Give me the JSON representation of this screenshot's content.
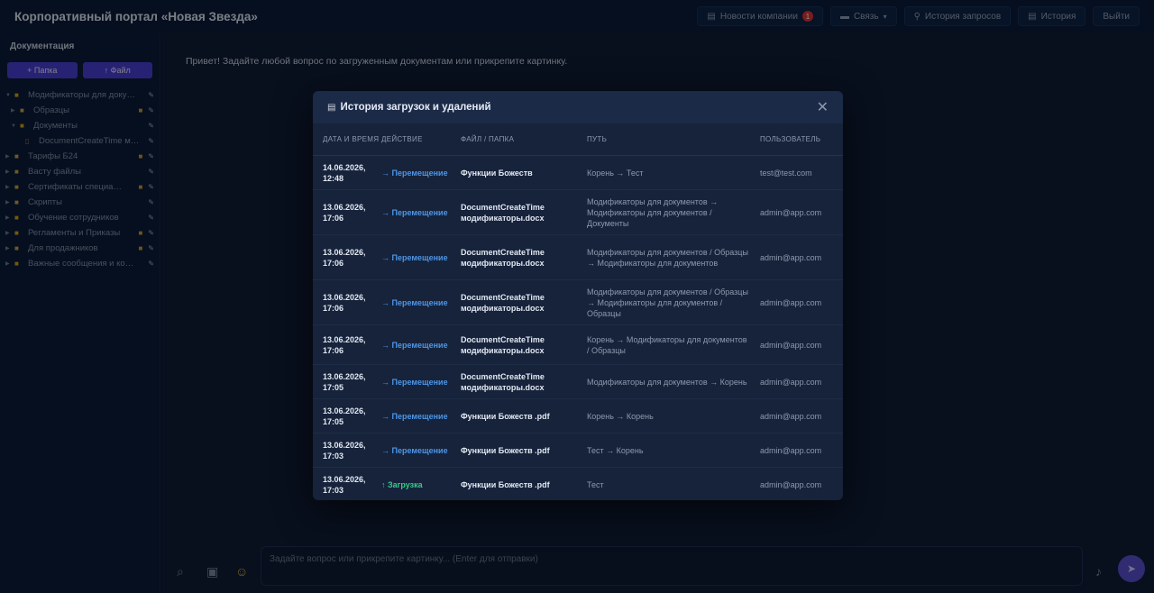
{
  "header": {
    "title": "Корпоративный портал «Новая Звезда»",
    "news_label": "Новости компании",
    "news_badge": "1",
    "connect_label": "Связь",
    "requests_label": "История запросов",
    "history_label": "История",
    "logout_label": "Выйти"
  },
  "sidebar": {
    "title": "Документация",
    "add_folder": "+ Папка",
    "add_file": "↑ Файл",
    "items": [
      {
        "label": "Модификаторы для доку…"
      },
      {
        "label": "Образцы"
      },
      {
        "label": "Документы"
      },
      {
        "label": "DocumentCreateTime м…"
      },
      {
        "label": "Тарифы Б24"
      },
      {
        "label": "Васту файлы"
      },
      {
        "label": "Сертификаты специа…"
      },
      {
        "label": "Скрипты"
      },
      {
        "label": "Обучение сотрудников"
      },
      {
        "label": "Регламенты и Приказы"
      },
      {
        "label": "Для продажников"
      },
      {
        "label": "Важные сообщения и ко…"
      }
    ]
  },
  "main": {
    "greeting": "Привет! Задайте любой вопрос по загруженным документам или прикрепите картинку.",
    "input_placeholder": "Задайте вопрос или прикрепите картинку... (Enter для отправки)"
  },
  "modal": {
    "title": "История загрузок и удалений",
    "columns": [
      "Дата и время",
      "Действие",
      "Файл / Папка",
      "Путь",
      "Пользователь"
    ],
    "rows": [
      {
        "date": "14.06.2026, 12:48",
        "action": "→ Перемещение",
        "file": "Функции Божеств",
        "path": "Корень → Тест",
        "user": "test@test.com"
      },
      {
        "date": "13.06.2026, 17:06",
        "action": "→ Перемещение",
        "file": "DocumentCreateTime модификаторы.docx",
        "path": "Модификаторы для документов → Модификаторы для документов / Документы",
        "user": "admin@app.com"
      },
      {
        "date": "13.06.2026, 17:06",
        "action": "→ Перемещение",
        "file": "DocumentCreateTime модификаторы.docx",
        "path": "Модификаторы для документов / Образцы → Модификаторы для документов",
        "user": "admin@app.com"
      },
      {
        "date": "13.06.2026, 17:06",
        "action": "→ Перемещение",
        "file": "DocumentCreateTime модификаторы.docx",
        "path": "Модификаторы для документов / Образцы → Модификаторы для документов / Образцы",
        "user": "admin@app.com"
      },
      {
        "date": "13.06.2026, 17:06",
        "action": "→ Перемещение",
        "file": "DocumentCreateTime модификаторы.docx",
        "path": "Корень → Модификаторы для документов / Образцы",
        "user": "admin@app.com"
      },
      {
        "date": "13.06.2026, 17:05",
        "action": "→ Перемещение",
        "file": "DocumentCreateTime модификаторы.docx",
        "path": "Модификаторы для документов → Корень",
        "user": "admin@app.com"
      },
      {
        "date": "13.06.2026, 17:05",
        "action": "→ Перемещение",
        "file": "Функции Божеств .pdf",
        "path": "Корень → Корень",
        "user": "admin@app.com"
      },
      {
        "date": "13.06.2026, 17:03",
        "action": "→ Перемещение",
        "file": "Функции Божеств .pdf",
        "path": "Тест → Корень",
        "user": "admin@app.com"
      },
      {
        "date": "13.06.2026, 17:03",
        "action": "↑ Загрузка",
        "file": "Функции Божеств .pdf",
        "path": "Тест",
        "user": "admin@app.com"
      }
    ]
  }
}
